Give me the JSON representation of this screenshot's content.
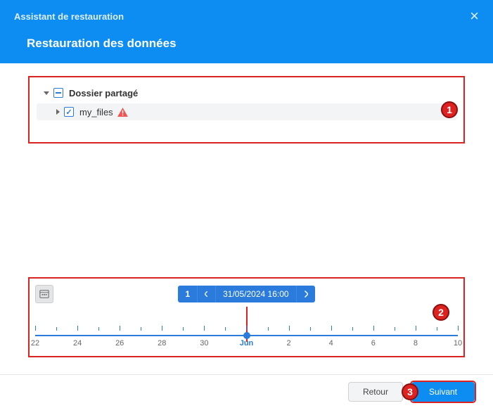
{
  "header": {
    "assistant_title": "Assistant de restauration",
    "page_title": "Restauration des données"
  },
  "tree": {
    "root": {
      "label": "Dossier partagé"
    },
    "child": {
      "label": "my_files"
    },
    "callout": "1"
  },
  "timeline": {
    "count": "1",
    "datetime": "31/05/2024 16:00",
    "callout": "2",
    "labels": [
      "22",
      "24",
      "26",
      "28",
      "30",
      "Jun",
      "2",
      "4",
      "6",
      "8",
      "10"
    ]
  },
  "footer": {
    "back": "Retour",
    "next": "Suivant",
    "callout": "3"
  }
}
